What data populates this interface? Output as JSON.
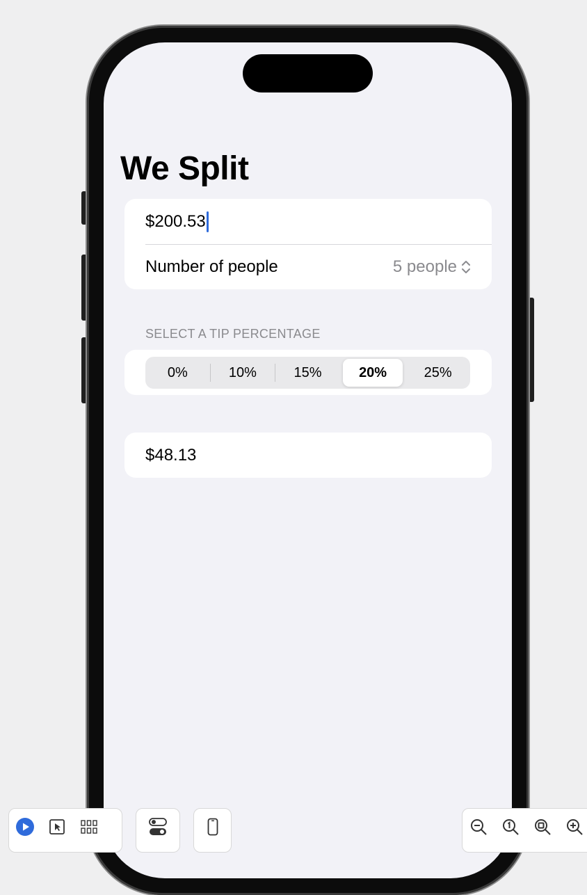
{
  "app": {
    "title": "We Split"
  },
  "form": {
    "amount": {
      "value": "$200.53"
    },
    "people": {
      "label": "Number of people",
      "value": "5 people"
    }
  },
  "tip": {
    "header": "SELECT A TIP PERCENTAGE",
    "options": [
      "0%",
      "10%",
      "15%",
      "20%",
      "25%"
    ],
    "selected": "20%"
  },
  "result": {
    "total": "$48.13"
  },
  "colors": {
    "accent": "#2f6bdb",
    "background": "#f2f2f7",
    "secondary_text": "#8a8a8e"
  },
  "toolbar": {
    "icons": [
      "play-icon",
      "select-icon",
      "grid-icon",
      "toggle-icon",
      "device-icon",
      "zoom-out-icon",
      "zoom-100-icon",
      "zoom-fit-icon",
      "zoom-in-icon"
    ]
  }
}
